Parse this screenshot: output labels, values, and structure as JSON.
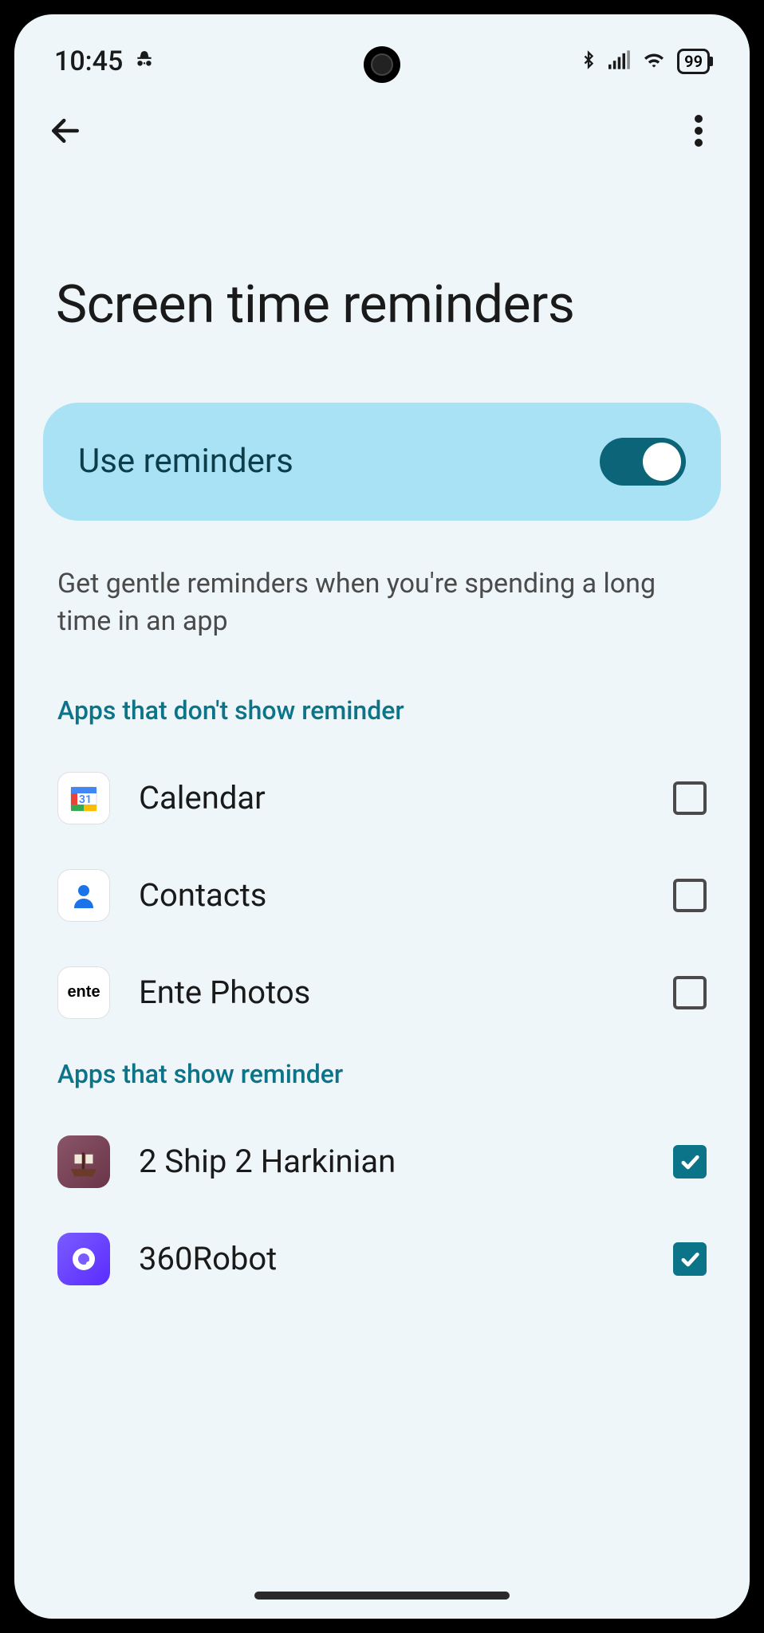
{
  "status": {
    "time": "10:45",
    "battery": "99"
  },
  "page": {
    "title": "Screen time reminders"
  },
  "toggle": {
    "label": "Use reminders",
    "enabled": true
  },
  "description": "Get gentle reminders when you're spending a long time in an app",
  "sections": {
    "excluded": {
      "header": "Apps that don't show reminder",
      "apps": [
        {
          "name": "Calendar",
          "icon": "calendar",
          "checked": false
        },
        {
          "name": "Contacts",
          "icon": "contacts",
          "checked": false
        },
        {
          "name": "Ente Photos",
          "icon": "ente",
          "checked": false
        }
      ]
    },
    "included": {
      "header": "Apps that show reminder",
      "apps": [
        {
          "name": "2 Ship 2 Harkinian",
          "icon": "ship",
          "checked": true
        },
        {
          "name": "360Robot",
          "icon": "robot",
          "checked": true
        }
      ]
    }
  }
}
